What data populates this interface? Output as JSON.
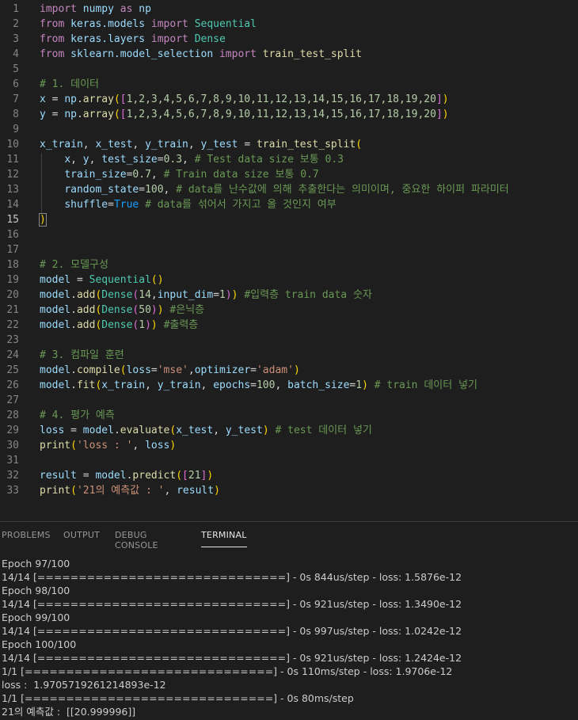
{
  "editor": {
    "lines": [
      {
        "n": "1",
        "tokens": [
          [
            "kw",
            "import"
          ],
          [
            "op",
            " "
          ],
          [
            "id",
            "numpy"
          ],
          [
            "op",
            " "
          ],
          [
            "kw",
            "as"
          ],
          [
            "op",
            " "
          ],
          [
            "id",
            "np"
          ]
        ]
      },
      {
        "n": "2",
        "tokens": [
          [
            "kw",
            "from"
          ],
          [
            "op",
            " "
          ],
          [
            "id",
            "keras.models"
          ],
          [
            "op",
            " "
          ],
          [
            "kw",
            "import"
          ],
          [
            "op",
            " "
          ],
          [
            "cls",
            "Sequential"
          ]
        ]
      },
      {
        "n": "3",
        "tokens": [
          [
            "kw",
            "from"
          ],
          [
            "op",
            " "
          ],
          [
            "id",
            "keras.layers"
          ],
          [
            "op",
            " "
          ],
          [
            "kw",
            "import"
          ],
          [
            "op",
            " "
          ],
          [
            "cls",
            "Dense"
          ]
        ]
      },
      {
        "n": "4",
        "tokens": [
          [
            "kw",
            "from"
          ],
          [
            "op",
            " "
          ],
          [
            "id",
            "sklearn.model_selection"
          ],
          [
            "op",
            " "
          ],
          [
            "kw",
            "import"
          ],
          [
            "op",
            " "
          ],
          [
            "fn",
            "train_test_split"
          ]
        ]
      },
      {
        "n": "5",
        "tokens": []
      },
      {
        "n": "6",
        "tokens": [
          [
            "cm",
            "# 1. 데이터"
          ]
        ]
      },
      {
        "n": "7",
        "tokens": [
          [
            "id",
            "x"
          ],
          [
            "op",
            " = "
          ],
          [
            "id",
            "np"
          ],
          [
            "op",
            "."
          ],
          [
            "fn",
            "array"
          ],
          [
            "b1",
            "("
          ],
          [
            "b2",
            "["
          ],
          [
            "num",
            "1,2,3,4,5,6,7,8,9,10,11,12,13,14,15,16,17,18,19,20"
          ],
          [
            "b2",
            "]"
          ],
          [
            "b1",
            ")"
          ]
        ]
      },
      {
        "n": "8",
        "tokens": [
          [
            "id",
            "y"
          ],
          [
            "op",
            " = "
          ],
          [
            "id",
            "np"
          ],
          [
            "op",
            "."
          ],
          [
            "fn",
            "array"
          ],
          [
            "b1",
            "("
          ],
          [
            "b2",
            "["
          ],
          [
            "num",
            "1,2,3,4,5,6,7,8,9,10,11,12,13,14,15,16,17,18,19,20"
          ],
          [
            "b2",
            "]"
          ],
          [
            "b1",
            ")"
          ]
        ]
      },
      {
        "n": "9",
        "tokens": []
      },
      {
        "n": "10",
        "tokens": [
          [
            "id",
            "x_train"
          ],
          [
            "op",
            ", "
          ],
          [
            "id",
            "x_test"
          ],
          [
            "op",
            ", "
          ],
          [
            "id",
            "y_train"
          ],
          [
            "op",
            ", "
          ],
          [
            "id",
            "y_test"
          ],
          [
            "op",
            " = "
          ],
          [
            "fn",
            "train_test_split"
          ],
          [
            "b1",
            "("
          ]
        ]
      },
      {
        "n": "11",
        "tokens": [
          [
            "op",
            "    "
          ],
          [
            "id",
            "x"
          ],
          [
            "op",
            ", "
          ],
          [
            "id",
            "y"
          ],
          [
            "op",
            ", "
          ],
          [
            "id",
            "test_size"
          ],
          [
            "op",
            "="
          ],
          [
            "num",
            "0.3"
          ],
          [
            "op",
            ", "
          ],
          [
            "cm",
            "# Test data size 보통 0.3"
          ]
        ]
      },
      {
        "n": "12",
        "tokens": [
          [
            "op",
            "    "
          ],
          [
            "id",
            "train_size"
          ],
          [
            "op",
            "="
          ],
          [
            "num",
            "0.7"
          ],
          [
            "op",
            ", "
          ],
          [
            "cm",
            "# Train data size 보통 0.7"
          ]
        ]
      },
      {
        "n": "13",
        "tokens": [
          [
            "op",
            "    "
          ],
          [
            "id",
            "random_state"
          ],
          [
            "op",
            "="
          ],
          [
            "num",
            "100"
          ],
          [
            "op",
            ", "
          ],
          [
            "cm",
            "# data를 난수값에 의해 추출한다는 의미이며, 중요한 하이퍼 파라미터"
          ]
        ]
      },
      {
        "n": "14",
        "tokens": [
          [
            "op",
            "    "
          ],
          [
            "id",
            "shuffle"
          ],
          [
            "op",
            "="
          ],
          [
            "b3",
            "True"
          ],
          [
            "op",
            " "
          ],
          [
            "cm",
            "# data를 섞어서 가지고 올 것인지 여부"
          ]
        ]
      },
      {
        "n": "15",
        "tokens": [
          [
            "b1",
            ")"
          ]
        ]
      },
      {
        "n": "16",
        "tokens": []
      },
      {
        "n": "17",
        "tokens": []
      },
      {
        "n": "18",
        "tokens": [
          [
            "cm",
            "# 2. 모델구성"
          ]
        ]
      },
      {
        "n": "19",
        "tokens": [
          [
            "id",
            "model"
          ],
          [
            "op",
            " = "
          ],
          [
            "cls",
            "Sequential"
          ],
          [
            "b1",
            "()"
          ]
        ]
      },
      {
        "n": "20",
        "tokens": [
          [
            "id",
            "model"
          ],
          [
            "op",
            "."
          ],
          [
            "fn",
            "add"
          ],
          [
            "b1",
            "("
          ],
          [
            "cls",
            "Dense"
          ],
          [
            "b2",
            "("
          ],
          [
            "num",
            "14"
          ],
          [
            "op",
            ","
          ],
          [
            "id",
            "input_dim"
          ],
          [
            "op",
            "="
          ],
          [
            "num",
            "1"
          ],
          [
            "b2",
            ")"
          ],
          [
            "b1",
            ")"
          ],
          [
            "op",
            " "
          ],
          [
            "cm",
            "#입력층 train data 숫자"
          ]
        ]
      },
      {
        "n": "21",
        "tokens": [
          [
            "id",
            "model"
          ],
          [
            "op",
            "."
          ],
          [
            "fn",
            "add"
          ],
          [
            "b1",
            "("
          ],
          [
            "cls",
            "Dense"
          ],
          [
            "b2",
            "("
          ],
          [
            "num",
            "50"
          ],
          [
            "b2",
            ")"
          ],
          [
            "b1",
            ")"
          ],
          [
            "op",
            " "
          ],
          [
            "cm",
            "#은닉층"
          ]
        ]
      },
      {
        "n": "22",
        "tokens": [
          [
            "id",
            "model"
          ],
          [
            "op",
            "."
          ],
          [
            "fn",
            "add"
          ],
          [
            "b1",
            "("
          ],
          [
            "cls",
            "Dense"
          ],
          [
            "b2",
            "("
          ],
          [
            "num",
            "1"
          ],
          [
            "b2",
            ")"
          ],
          [
            "b1",
            ")"
          ],
          [
            "op",
            " "
          ],
          [
            "cm",
            "#출력층"
          ]
        ]
      },
      {
        "n": "23",
        "tokens": []
      },
      {
        "n": "24",
        "tokens": [
          [
            "cm",
            "# 3. 컴파일 훈련"
          ]
        ]
      },
      {
        "n": "25",
        "tokens": [
          [
            "id",
            "model"
          ],
          [
            "op",
            "."
          ],
          [
            "fn",
            "compile"
          ],
          [
            "b1",
            "("
          ],
          [
            "id",
            "loss"
          ],
          [
            "op",
            "="
          ],
          [
            "str",
            "'mse'"
          ],
          [
            "op",
            ","
          ],
          [
            "id",
            "optimizer"
          ],
          [
            "op",
            "="
          ],
          [
            "str",
            "'adam'"
          ],
          [
            "b1",
            ")"
          ]
        ]
      },
      {
        "n": "26",
        "tokens": [
          [
            "id",
            "model"
          ],
          [
            "op",
            "."
          ],
          [
            "fn",
            "fit"
          ],
          [
            "b1",
            "("
          ],
          [
            "id",
            "x_train"
          ],
          [
            "op",
            ", "
          ],
          [
            "id",
            "y_train"
          ],
          [
            "op",
            ", "
          ],
          [
            "id",
            "epochs"
          ],
          [
            "op",
            "="
          ],
          [
            "num",
            "100"
          ],
          [
            "op",
            ", "
          ],
          [
            "id",
            "batch_size"
          ],
          [
            "op",
            "="
          ],
          [
            "num",
            "1"
          ],
          [
            "b1",
            ")"
          ],
          [
            "op",
            " "
          ],
          [
            "cm",
            "# train 데이터 넣기"
          ]
        ]
      },
      {
        "n": "27",
        "tokens": []
      },
      {
        "n": "28",
        "tokens": [
          [
            "cm",
            "# 4. 평가 예측"
          ]
        ]
      },
      {
        "n": "29",
        "tokens": [
          [
            "id",
            "loss"
          ],
          [
            "op",
            " = "
          ],
          [
            "id",
            "model"
          ],
          [
            "op",
            "."
          ],
          [
            "fn",
            "evaluate"
          ],
          [
            "b1",
            "("
          ],
          [
            "id",
            "x_test"
          ],
          [
            "op",
            ", "
          ],
          [
            "id",
            "y_test"
          ],
          [
            "b1",
            ")"
          ],
          [
            "op",
            " "
          ],
          [
            "cm",
            "# test 데이터 넣기"
          ]
        ]
      },
      {
        "n": "30",
        "tokens": [
          [
            "fn",
            "print"
          ],
          [
            "b1",
            "("
          ],
          [
            "str",
            "'loss : '"
          ],
          [
            "op",
            ", "
          ],
          [
            "id",
            "loss"
          ],
          [
            "b1",
            ")"
          ]
        ]
      },
      {
        "n": "31",
        "tokens": []
      },
      {
        "n": "32",
        "tokens": [
          [
            "id",
            "result"
          ],
          [
            "op",
            " = "
          ],
          [
            "id",
            "model"
          ],
          [
            "op",
            "."
          ],
          [
            "fn",
            "predict"
          ],
          [
            "b1",
            "("
          ],
          [
            "b2",
            "["
          ],
          [
            "num",
            "21"
          ],
          [
            "b2",
            "]"
          ],
          [
            "b1",
            ")"
          ]
        ]
      },
      {
        "n": "33",
        "tokens": [
          [
            "fn",
            "print"
          ],
          [
            "b1",
            "("
          ],
          [
            "str",
            "'21의 예측값 : '"
          ],
          [
            "op",
            ", "
          ],
          [
            "id",
            "result"
          ],
          [
            "b1",
            ")"
          ]
        ]
      }
    ]
  },
  "panel": {
    "tabs": [
      {
        "label": "PROBLEMS",
        "active": false
      },
      {
        "label": "OUTPUT",
        "active": false
      },
      {
        "label": "DEBUG CONSOLE",
        "active": false
      },
      {
        "label": "TERMINAL",
        "active": true
      }
    ],
    "terminal_lines": [
      "Epoch 97/100",
      "14/14 [==============================] - 0s 844us/step - loss: 1.5876e-12",
      "Epoch 98/100",
      "14/14 [==============================] - 0s 921us/step - loss: 1.3490e-12",
      "Epoch 99/100",
      "14/14 [==============================] - 0s 997us/step - loss: 1.0242e-12",
      "Epoch 100/100",
      "14/14 [==============================] - 0s 921us/step - loss: 1.2424e-12",
      "1/1 [==============================] - 0s 110ms/step - loss: 1.9706e-12",
      "loss :  1.9705719261214893e-12",
      "1/1 [==============================] - 0s 80ms/step",
      "21의 예측값 :  [[20.999996]]"
    ]
  }
}
